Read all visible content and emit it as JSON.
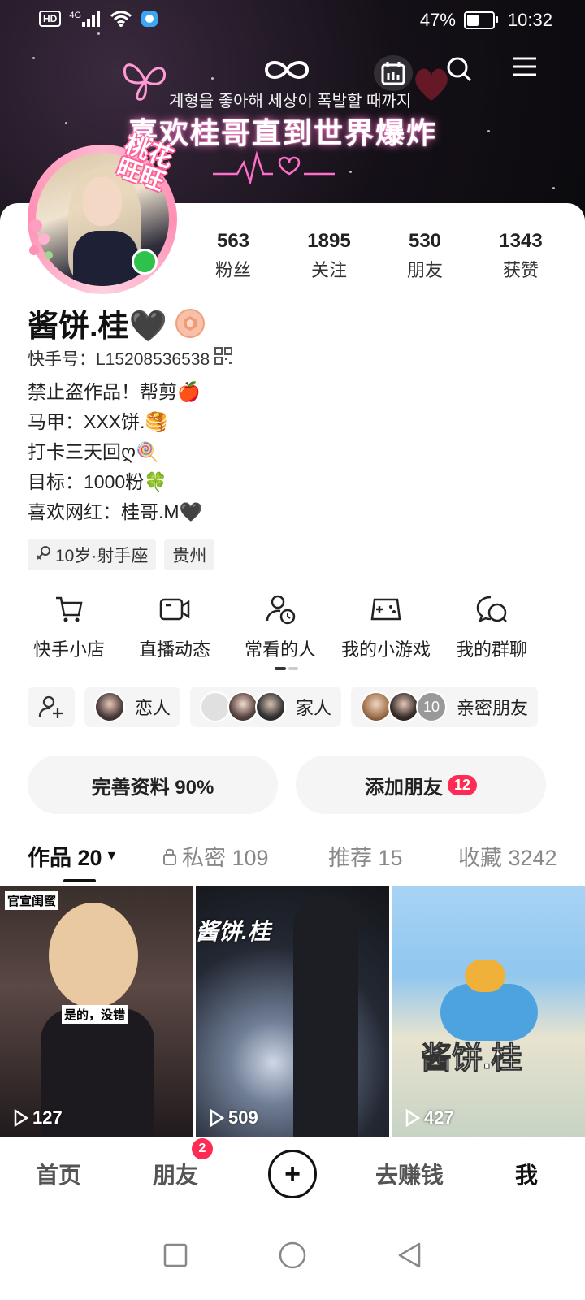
{
  "status_bar": {
    "hd": "HD",
    "network": "4G",
    "battery_percent": "47%",
    "battery_level": 0.47,
    "time": "10:32"
  },
  "banner": {
    "korean_text": "계형을 좋아해 세상이 폭발할 때까지",
    "title": "喜欢桂哥直到世界爆炸"
  },
  "avatar": {
    "tag": "桃花旺旺",
    "online": true
  },
  "stats": [
    {
      "num": "563",
      "label": "粉丝"
    },
    {
      "num": "1895",
      "label": "关注"
    },
    {
      "num": "530",
      "label": "朋友"
    },
    {
      "num": "1343",
      "label": "获赞"
    }
  ],
  "profile": {
    "name": "酱饼.桂🖤",
    "kuaishou_id_label": "快手号：L15208536538",
    "bio": [
      "禁止盗作品！帮剪🍎",
      "马甲：XXX饼.🥞",
      "打卡三天回ღ🍭",
      "目标：1000粉🍀",
      "喜欢网红：桂哥.M🖤"
    ],
    "tags": [
      "10岁·射手座",
      "贵州"
    ]
  },
  "features": [
    {
      "label": "快手小店",
      "icon": "cart-icon"
    },
    {
      "label": "直播动态",
      "icon": "camera-icon"
    },
    {
      "label": "常看的人",
      "icon": "person-clock-icon"
    },
    {
      "label": "我的小游戏",
      "icon": "gamepad-icon"
    },
    {
      "label": "我的群聊",
      "icon": "chat-icon"
    }
  ],
  "relations": {
    "lover": "恋人",
    "family": "家人",
    "close_friends_count": "10",
    "close_friends": "亲密朋友"
  },
  "actions": {
    "complete_profile": "完善资料 90%",
    "add_friend": "添加朋友",
    "add_friend_badge": "12"
  },
  "tabs": [
    {
      "label": "作品 20"
    },
    {
      "label": "私密 109"
    },
    {
      "label": "推荐 15"
    },
    {
      "label": "收藏 3242"
    }
  ],
  "grid": [
    {
      "views": "127",
      "caption_top": "官宣闺蜜",
      "caption_mid": "是的，没错"
    },
    {
      "views": "509",
      "caption_top": "酱饼.桂"
    },
    {
      "views": "427",
      "caption_top": "酱饼.桂"
    }
  ],
  "bottom_nav": {
    "home": "首页",
    "friends": "朋友",
    "friends_badge": "2",
    "earn": "去赚钱",
    "me": "我"
  },
  "colors": {
    "accent": "#fe2c55",
    "online": "#2fc24a"
  }
}
